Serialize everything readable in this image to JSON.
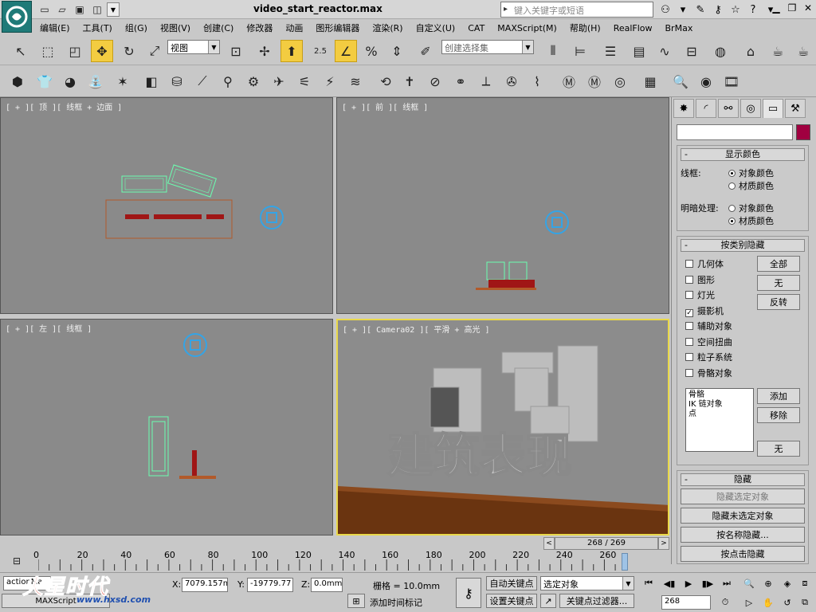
{
  "window": {
    "title": "video_start_reactor.max",
    "search_placeholder": "键入关键字或短语"
  },
  "menu": [
    "编辑(E)",
    "工具(T)",
    "组(G)",
    "视图(V)",
    "创建(C)",
    "修改器",
    "动画",
    "图形编辑器",
    "渲染(R)",
    "自定义(U)",
    "CAT",
    "MAXScript(M)",
    "帮助(H)",
    "RealFlow",
    "BrMax"
  ],
  "toolbar": {
    "view_dropdown": "视图",
    "snap_label": "2.5",
    "selection_set": "创建选择集"
  },
  "viewports": {
    "top": "[ + ][ 顶 ][ 线框 + 边面 ]",
    "front": "[ + ][ 前 ][ 线框 ]",
    "left": "[ + ][ 左 ][ 线框 ]",
    "camera": "[ + ][ Camera02 ][ 平滑 + 高光 ]",
    "camera_text": "建筑表现"
  },
  "command_panel": {
    "display_color": {
      "title": "显示颜色",
      "wireframe_label": "线框:",
      "shaded_label": "明暗处理:",
      "object_color": "对象颜色",
      "material_color": "材质颜色"
    },
    "hide_by_category": {
      "title": "按类别隐藏",
      "items": [
        {
          "label": "几何体",
          "checked": false
        },
        {
          "label": "图形",
          "checked": false
        },
        {
          "label": "灯光",
          "checked": false
        },
        {
          "label": "摄影机",
          "checked": true
        },
        {
          "label": "辅助对象",
          "checked": false
        },
        {
          "label": "空间扭曲",
          "checked": false
        },
        {
          "label": "粒子系统",
          "checked": false
        },
        {
          "label": "骨骼对象",
          "checked": false
        }
      ],
      "all_btn": "全部",
      "none_btn": "无",
      "invert_btn": "反转",
      "list_items": [
        "骨骼",
        "IK 链对象",
        "点"
      ],
      "add_btn": "添加",
      "remove_btn": "移除",
      "none2_btn": "无"
    },
    "hide": {
      "title": "隐藏",
      "hide_selected": "隐藏选定对象",
      "hide_unselected": "隐藏未选定对象",
      "hide_by_name": "按名称隐藏...",
      "hide_by_hit": "按点击隐藏"
    }
  },
  "timeline": {
    "frame_display": "268 / 269",
    "ticks": [
      "0",
      "20",
      "40",
      "60",
      "80",
      "100",
      "120",
      "140",
      "160",
      "180",
      "200",
      "220",
      "240",
      "260"
    ],
    "current_fraction": 0.996
  },
  "status": {
    "script_field": "actionMa",
    "x_label": "X:",
    "x_value": "7079.157m",
    "y_label": "Y:",
    "y_value": "-19779.77",
    "z_label": "Z:",
    "z_value": "0.0mm",
    "grid": "栅格 = 10.0mm",
    "auto_key": "自动关键点",
    "set_key": "设置关键点",
    "selected_dropdown": "选定对象",
    "key_filters": "关键点过滤器...",
    "add_time_tag": "添加时间标记",
    "frame_field": "268",
    "maxscript_tab": "MAXScript"
  },
  "watermark": {
    "text": "火星时代",
    "url": "www.hxsd.com"
  },
  "colors": {
    "accent_active": "#f3cc41",
    "viewport_bg": "#8a8a8a",
    "object_color_swatch": "#a00040"
  }
}
